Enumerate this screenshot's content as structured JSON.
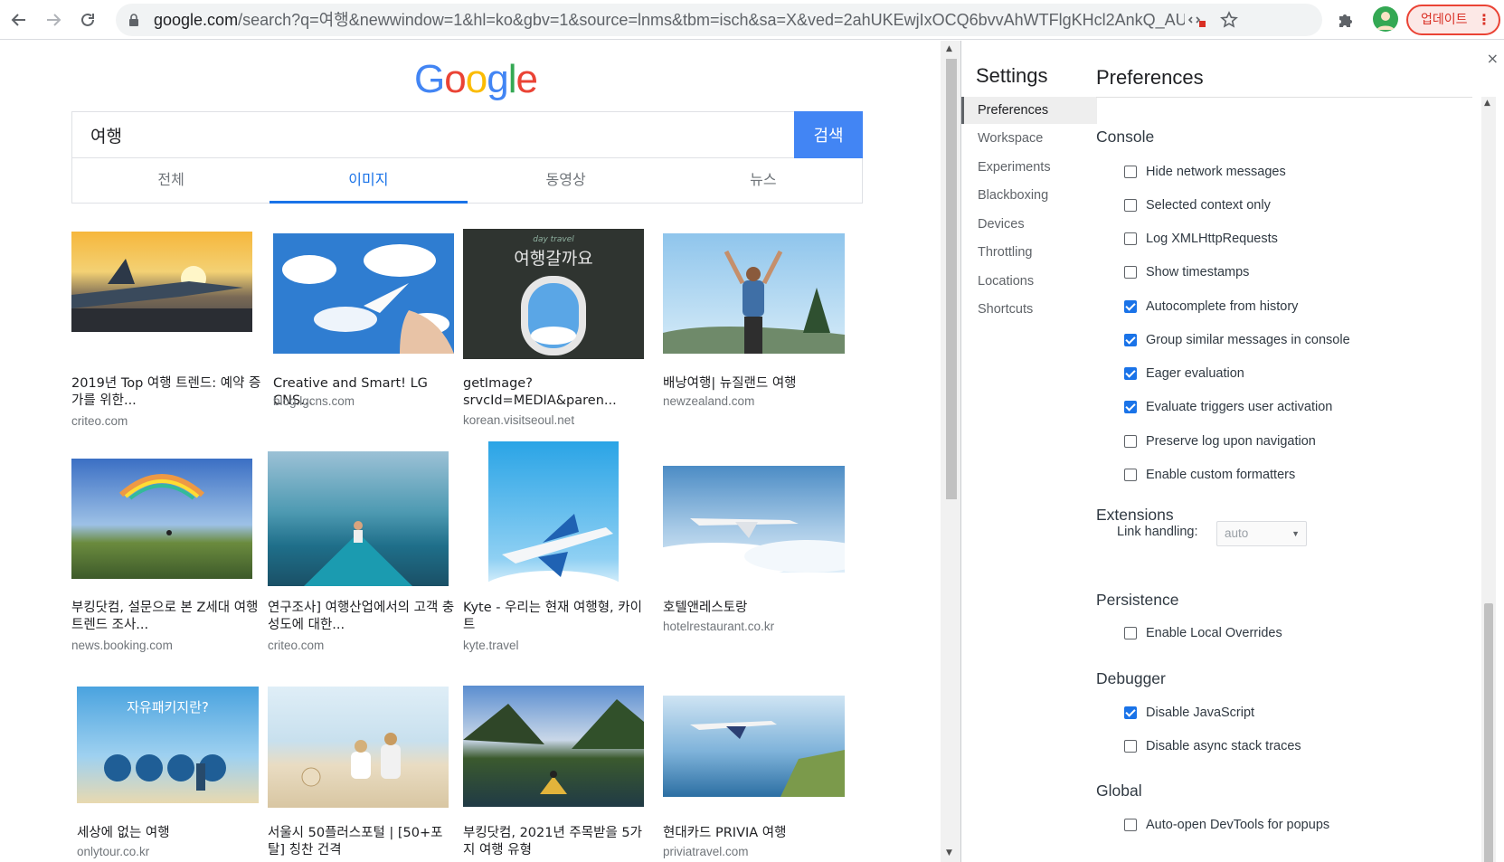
{
  "browser": {
    "url_host": "google.com",
    "url_rest": "/search?q=여행&newwindow=1&hl=ko&gbv=1&source=lnms&tbm=isch&sa=X&ved=2ahUKEwjIxOCQ6bvvAhWTFlgKHcl2AnkQ_AUoAXo...",
    "update_label": "업데이트",
    "menu_dots": "⋮"
  },
  "google": {
    "logo_letters": [
      "G",
      "o",
      "o",
      "g",
      "l",
      "e"
    ],
    "logo_colors": [
      "#4285f4",
      "#ea4335",
      "#fbbc05",
      "#4285f4",
      "#34a853",
      "#ea4335"
    ],
    "query": "여행",
    "search_button": "검색",
    "tabs": [
      "전체",
      "이미지",
      "동영상",
      "뉴스"
    ],
    "active_tab": "이미지"
  },
  "results": [
    {
      "caption": "2019년 Top 여행 트렌드: 예약 증가를 위한...",
      "source": "criteo.com"
    },
    {
      "caption": "Creative and Smart! LG CNS...",
      "source": "blog.lgcns.com"
    },
    {
      "caption": "getImage? srvcId=MEDIA&paren...",
      "source": "korean.visitseoul.net",
      "thumb_text": "여행갈까요",
      "thumb_small": "day travel"
    },
    {
      "caption": "배낭여행| 뉴질랜드 여행",
      "source": "newzealand.com"
    },
    {
      "caption": "부킹닷컴, 설문으로 본 Z세대 여행 트렌드 조사...",
      "source": "news.booking.com"
    },
    {
      "caption": "연구조사] 여행산업에서의 고객 충성도에 대한...",
      "source": "criteo.com"
    },
    {
      "caption": "Kyte - 우리는 현재 여행형, 카이트",
      "source": "kyte.travel"
    },
    {
      "caption": "호텔앤레스토랑",
      "source": "hotelrestaurant.co.kr"
    },
    {
      "caption": "세상에 없는 여행",
      "source": "onlytour.co.kr",
      "thumb_text": "자유패키지란?"
    },
    {
      "caption": "서울시 50플러스포털 | [50+포탈] 칭찬 건격",
      "source": ""
    },
    {
      "caption": "부킹닷컴, 2021년 주목받을 5가지 여행 유형",
      "source": ""
    },
    {
      "caption": "현대카드 PRIVIA 여행",
      "source": "priviatravel.com"
    }
  ],
  "devtools": {
    "close": "×",
    "settings_title": "Settings",
    "nav": [
      "Preferences",
      "Workspace",
      "Experiments",
      "Blackboxing",
      "Devices",
      "Throttling",
      "Locations",
      "Shortcuts"
    ],
    "active_nav": "Preferences",
    "preferences_title": "Preferences",
    "sections": {
      "console": {
        "title": "Console",
        "options": [
          {
            "label": "Hide network messages",
            "checked": false
          },
          {
            "label": "Selected context only",
            "checked": false
          },
          {
            "label": "Log XMLHttpRequests",
            "checked": false
          },
          {
            "label": "Show timestamps",
            "checked": false
          },
          {
            "label": "Autocomplete from history",
            "checked": true
          },
          {
            "label": "Group similar messages in console",
            "checked": true
          },
          {
            "label": "Eager evaluation",
            "checked": true
          },
          {
            "label": "Evaluate triggers user activation",
            "checked": true
          },
          {
            "label": "Preserve log upon navigation",
            "checked": false
          },
          {
            "label": "Enable custom formatters",
            "checked": false
          }
        ]
      },
      "extensions": {
        "title": "Extensions",
        "link_handling_label": "Link handling:",
        "link_handling_value": "auto"
      },
      "persistence": {
        "title": "Persistence",
        "options": [
          {
            "label": "Enable Local Overrides",
            "checked": false
          }
        ]
      },
      "debugger": {
        "title": "Debugger",
        "options": [
          {
            "label": "Disable JavaScript",
            "checked": true
          },
          {
            "label": "Disable async stack traces",
            "checked": false
          }
        ]
      },
      "global": {
        "title": "Global",
        "options": [
          {
            "label": "Auto-open DevTools for popups",
            "checked": false
          }
        ]
      }
    }
  }
}
